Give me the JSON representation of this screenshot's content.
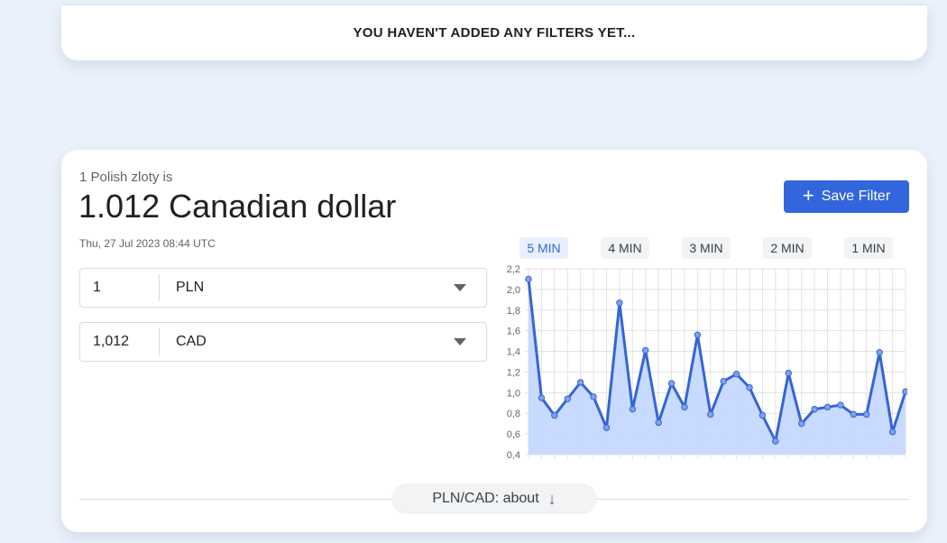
{
  "filters": {
    "empty_message": "YOU HAVEN'T ADDED ANY FILTERS YET..."
  },
  "converter": {
    "subheading": "1 Polish zloty is",
    "headline": "1.012 Canadian dollar",
    "timestamp": "Thu, 27 Jul 2023 08:44 UTC",
    "save_button": "Save Filter",
    "from": {
      "amount": "1",
      "currency": "PLN"
    },
    "to": {
      "amount": "1,012",
      "currency": "CAD"
    },
    "about": "PLN/CAD: about",
    "ranges": [
      {
        "label": "5 MIN",
        "active": true
      },
      {
        "label": "4 MIN",
        "active": false
      },
      {
        "label": "3 MIN",
        "active": false
      },
      {
        "label": "2 MIN",
        "active": false
      },
      {
        "label": "1 MIN",
        "active": false
      }
    ]
  },
  "colors": {
    "accent": "#3366dd",
    "line": "#3565d4",
    "area": "#c5d8ff",
    "background": "#e9f1fa"
  },
  "chart_data": {
    "type": "area",
    "title": "",
    "xlabel": "",
    "ylabel": "",
    "ylim": [
      0.4,
      2.2
    ],
    "yticks": [
      "2,2",
      "2,0",
      "1,8",
      "1,6",
      "1,4",
      "1,2",
      "1,0",
      "0,8",
      "0,6",
      "0,4"
    ],
    "grid": true,
    "series": [
      {
        "values": [
          2.1,
          0.95,
          0.78,
          0.94,
          1.1,
          0.96,
          0.66,
          1.87,
          0.84,
          1.41,
          0.71,
          1.09,
          0.86,
          1.56,
          0.79,
          1.11,
          1.18,
          1.05,
          0.78,
          0.53,
          1.19,
          0.7,
          0.84,
          0.86,
          0.88,
          0.79,
          0.79,
          1.39,
          0.62,
          1.01
        ]
      }
    ]
  }
}
